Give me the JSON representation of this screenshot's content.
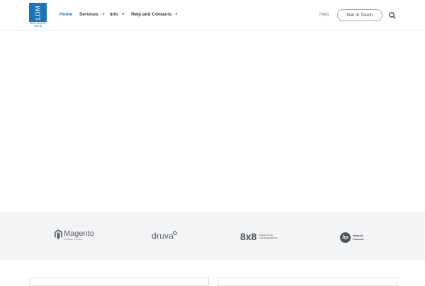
{
  "logo": {
    "mark": "LDM",
    "subtitle": "LEAN DIGITAL MEDIA"
  },
  "nav": {
    "items": [
      {
        "label": "Home"
      },
      {
        "label": "Services"
      },
      {
        "label": "Info"
      },
      {
        "label": "Help and Contacts"
      }
    ],
    "help_label": "Help",
    "cta_label": "Get In Touch",
    "search_icon": "search-icon"
  },
  "brands": {
    "magento": {
      "name": "Magento",
      "tagline": "An Adobe Company"
    },
    "druva": {
      "name": "druva"
    },
    "eightx8": {
      "name": "8x8",
      "tagline": "Global Cloud Communications"
    },
    "hp": {
      "mark": "hp",
      "line1": "Hewlett",
      "line2": "Packard"
    }
  },
  "colors": {
    "accent": "#1f73b7",
    "strip_bg": "#f3f4f6",
    "text": "#333333"
  }
}
